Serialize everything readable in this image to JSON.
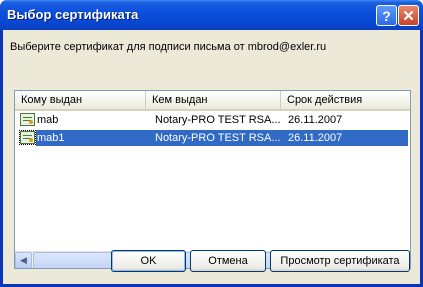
{
  "window": {
    "title": "Выбор сертификата",
    "help_label": "?",
    "close_label": "✕"
  },
  "prompt": "Выберите сертификат для подписи письма от mbrod@exler.ru",
  "list": {
    "columns": [
      "Кому выдан",
      "Кем выдан",
      "Срок действия"
    ],
    "rows": [
      {
        "issued_to": "mab",
        "issued_by": "Notary-PRO TEST RSA...",
        "expires": "26.11.2007",
        "selected": false
      },
      {
        "issued_to": "mab1",
        "issued_by": "Notary-PRO TEST RSA...",
        "expires": "26.11.2007",
        "selected": true
      }
    ],
    "row_icon": "certificate-icon"
  },
  "scrollbar": {
    "left_arrow": "◀",
    "right_arrow": "▶"
  },
  "buttons": {
    "ok": "OK",
    "cancel": "Отмена",
    "view": "Просмотр сертификата"
  },
  "colors": {
    "titlebar": "#0a4fdc",
    "selection": "#316ac5",
    "dialog_bg": "#ece9d8"
  }
}
